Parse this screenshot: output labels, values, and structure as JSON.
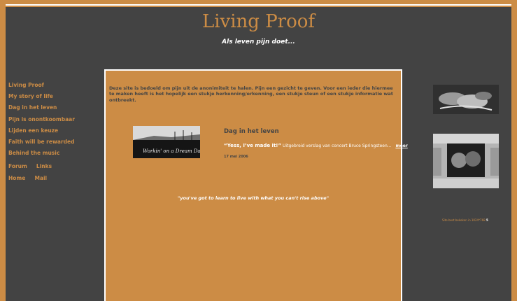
{
  "site": {
    "title": "Living Proof",
    "subtitle": "Als leven pijn doet..."
  },
  "nav": {
    "items": [
      {
        "label": "Living Proof"
      },
      {
        "label": "My story of life"
      },
      {
        "label": "Dag in het leven"
      },
      {
        "label": "Pijn is onontkoombaar"
      },
      {
        "label": "Lijden een keuze"
      },
      {
        "label": "Faith will be rewarded"
      },
      {
        "label": "Behind the music"
      }
    ],
    "pair1": [
      "Forum",
      "Links"
    ],
    "pair2": [
      "Home",
      "Mail"
    ]
  },
  "content": {
    "intro": "Deze site is bedoeld om pijn uit de anonimiteit te halen. Pijn een gezicht te geven. Voor een ieder die hiermee te maken heeft is het hopelijk een stukje herkenning/erkenning, een stukje steun of een stukje informatie wat ontbreekt.",
    "article": {
      "title": "Dag in het leven",
      "quote": "“Yess, I’ve made it!”",
      "summary": "Uitgebreid verslag van concert Bruce Springsteen...",
      "more_label": "meer",
      "date": "17 mei 2006",
      "thumb_text": "Workin' on a Dream Day"
    },
    "bottom_quote": "\"you've got to learn to live with what you can't rise above\""
  },
  "side": {
    "note": "Site best bekeken in 1024*768",
    "note_suffix": "5"
  },
  "colors": {
    "accent": "#cc8c45",
    "background": "#434343",
    "text_dark": "#444444",
    "text_light": "#ffffff"
  },
  "icons": {
    "photo1": "hands-photo",
    "photo2": "portrait-collage-photo"
  }
}
